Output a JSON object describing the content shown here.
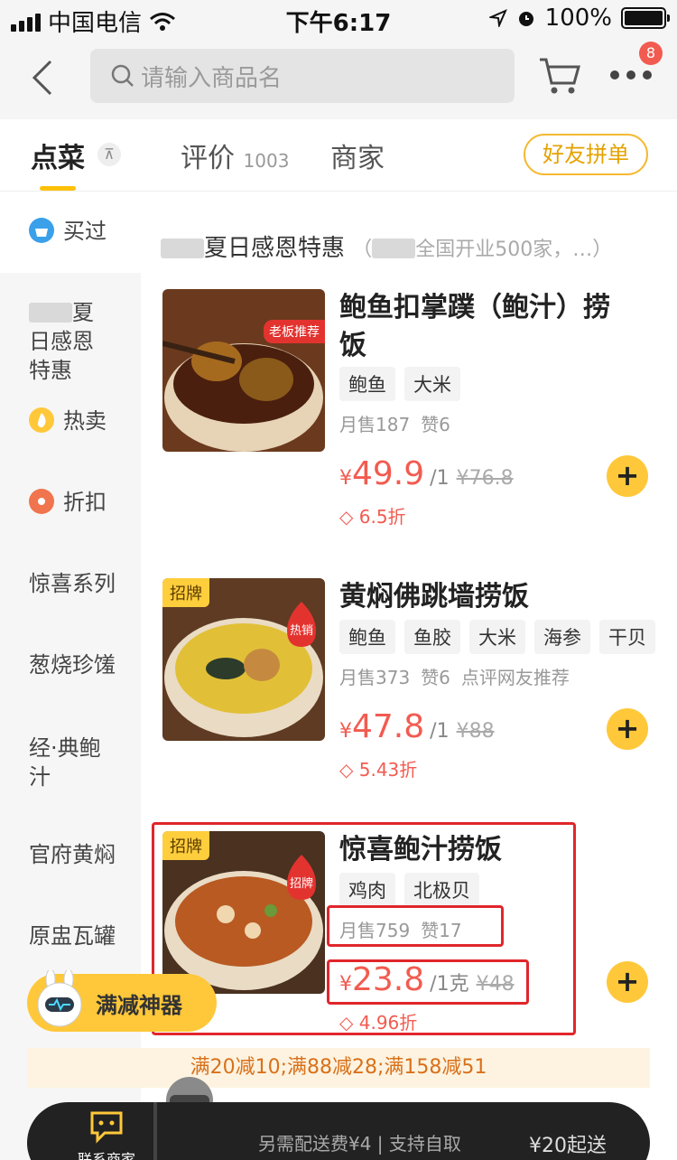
{
  "status_bar": {
    "carrier": "中国电信",
    "time": "下午6:17",
    "battery": "100%"
  },
  "nav": {
    "search_placeholder": "请输入商品名",
    "cart_badge": "8"
  },
  "tabs": [
    {
      "label": "点菜"
    },
    {
      "label": "评价",
      "count": "1003"
    },
    {
      "label": "商家"
    }
  ],
  "group_buy_label": "好友拼单",
  "sidebar": {
    "items": [
      {
        "label": "买过"
      },
      {
        "label": "夏日感恩特惠"
      },
      {
        "label": "热卖"
      },
      {
        "label": "折扣"
      },
      {
        "label": "惊喜系列"
      },
      {
        "label": "葱烧珍馐"
      },
      {
        "label": "经·典鲍汁"
      },
      {
        "label": "官府黄焖"
      },
      {
        "label": "原盅瓦罐"
      }
    ]
  },
  "section": {
    "title": "夏日感恩特惠",
    "subtitle": "全国开业500家，…"
  },
  "items": [
    {
      "title": "鲍鱼扣掌蹼（鲍汁）捞饭",
      "badge": "老板推荐",
      "tags": [
        "鲍鱼",
        "大米"
      ],
      "monthly_sales": "月售187",
      "likes": "赞6",
      "price": "49.9",
      "unit": "/1",
      "original_price": "¥76.8",
      "discount": "6.5折"
    },
    {
      "title": "黄焖佛跳墙捞饭",
      "label": "招牌",
      "badge": "热销",
      "tags": [
        "鲍鱼",
        "鱼胶",
        "大米",
        "海参",
        "干贝"
      ],
      "monthly_sales": "月售373",
      "likes": "赞6",
      "recommend": "点评网友推荐",
      "price": "47.8",
      "unit": "/1",
      "original_price": "¥88",
      "discount": "5.43折"
    },
    {
      "title": "惊喜鲍汁捞饭",
      "label": "招牌",
      "badge": "招牌",
      "tags": [
        "鸡肉",
        "北极贝"
      ],
      "monthly_sales": "月售759",
      "likes": "赞17",
      "price": "23.8",
      "unit": "/1克",
      "original_price": "¥48",
      "discount": "4.96折"
    }
  ],
  "floating_button": "满减神器",
  "promo_text": "满20减10;满88减28;满158减51",
  "bottom_bar": {
    "contact": "联系商家",
    "delivery": "另需配送费¥4 | 支持自取",
    "min_order": "¥20起送"
  },
  "yen": "¥",
  "colors": {
    "accent": "#ffc83a",
    "price": "#f25b50",
    "highlight": "#e0262b"
  }
}
